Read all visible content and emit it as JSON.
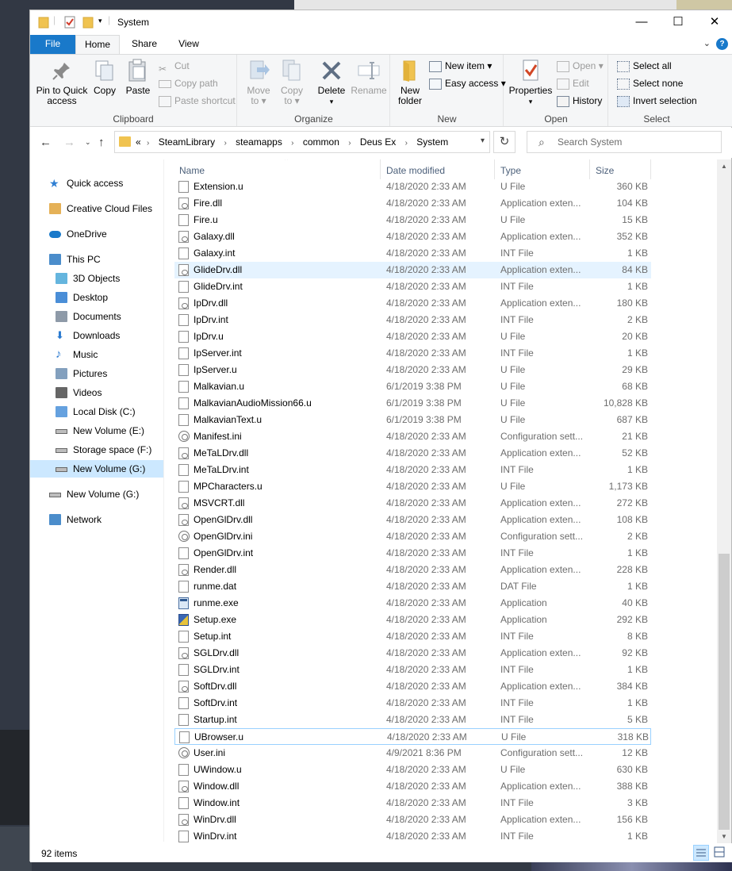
{
  "window": {
    "title": "System",
    "minimize": "—",
    "maximize": "☐",
    "close": "✕"
  },
  "ribbon_tabs": [
    "File",
    "Home",
    "Share",
    "View"
  ],
  "ribbon": {
    "clipboard": {
      "label": "Clipboard",
      "pin": "Pin to Quick access",
      "pin_line1": "Pin to Quick",
      "pin_line2": "access",
      "copy": "Copy",
      "paste": "Paste",
      "cut": "Cut",
      "copy_path": "Copy path",
      "paste_shortcut": "Paste shortcut"
    },
    "organize": {
      "label": "Organize",
      "move_to_line1": "Move",
      "move_to_line2": "to ▾",
      "copy_to_line1": "Copy",
      "copy_to_line2": "to ▾",
      "delete": "Delete",
      "delete_arrow": "▾",
      "rename": "Rename"
    },
    "new": {
      "label": "New",
      "new_folder_line1": "New",
      "new_folder_line2": "folder",
      "new_item": "New item ▾",
      "easy_access": "Easy access ▾"
    },
    "open": {
      "label": "Open",
      "properties": "Properties",
      "properties_arrow": "▾",
      "open": "Open ▾",
      "edit": "Edit",
      "history": "History"
    },
    "select": {
      "label": "Select",
      "select_all": "Select all",
      "select_none": "Select none",
      "invert_selection": "Invert selection"
    }
  },
  "address": {
    "overflow": "«",
    "crumbs": [
      "SteamLibrary",
      "steamapps",
      "common",
      "Deus Ex",
      "System"
    ],
    "separator": "›"
  },
  "search": {
    "placeholder": "Search System"
  },
  "nav_pane": [
    {
      "label": "Quick access",
      "icon": "star-icon"
    },
    {
      "label": "Creative Cloud Files",
      "icon": "creative-cloud-icon"
    },
    {
      "label": "OneDrive",
      "icon": "cloud-icon"
    },
    {
      "label": "This PC",
      "icon": "computer-icon"
    },
    {
      "label": "3D Objects",
      "icon": "cube-icon"
    },
    {
      "label": "Desktop",
      "icon": "desktop-icon"
    },
    {
      "label": "Documents",
      "icon": "document-icon"
    },
    {
      "label": "Downloads",
      "icon": "download-icon"
    },
    {
      "label": "Music",
      "icon": "music-icon"
    },
    {
      "label": "Pictures",
      "icon": "pictures-icon"
    },
    {
      "label": "Videos",
      "icon": "video-icon"
    },
    {
      "label": "Local Disk (C:)",
      "icon": "windows-drive-icon"
    },
    {
      "label": "New Volume (E:)",
      "icon": "drive-icon"
    },
    {
      "label": "Storage space (F:)",
      "icon": "drive-icon"
    },
    {
      "label": "New Volume (G:)",
      "icon": "drive-icon"
    },
    {
      "label": "New Volume (G:)",
      "icon": "drive-icon"
    },
    {
      "label": "Network",
      "icon": "network-icon"
    }
  ],
  "columns": {
    "name": "Name",
    "date": "Date modified",
    "type": "Type",
    "size": "Size"
  },
  "files": [
    {
      "name": "Extension.u",
      "date": "4/18/2020 2:33 AM",
      "type": "U File",
      "size": "360 KB",
      "icon": "file"
    },
    {
      "name": "Fire.dll",
      "date": "4/18/2020 2:33 AM",
      "type": "Application exten...",
      "size": "104 KB",
      "icon": "dll"
    },
    {
      "name": "Fire.u",
      "date": "4/18/2020 2:33 AM",
      "type": "U File",
      "size": "15 KB",
      "icon": "file"
    },
    {
      "name": "Galaxy.dll",
      "date": "4/18/2020 2:33 AM",
      "type": "Application exten...",
      "size": "352 KB",
      "icon": "dll"
    },
    {
      "name": "Galaxy.int",
      "date": "4/18/2020 2:33 AM",
      "type": "INT File",
      "size": "1 KB",
      "icon": "file"
    },
    {
      "name": "GlideDrv.dll",
      "date": "4/18/2020 2:33 AM",
      "type": "Application exten...",
      "size": "84 KB",
      "icon": "dll"
    },
    {
      "name": "GlideDrv.int",
      "date": "4/18/2020 2:33 AM",
      "type": "INT File",
      "size": "1 KB",
      "icon": "file"
    },
    {
      "name": "IpDrv.dll",
      "date": "4/18/2020 2:33 AM",
      "type": "Application exten...",
      "size": "180 KB",
      "icon": "dll"
    },
    {
      "name": "IpDrv.int",
      "date": "4/18/2020 2:33 AM",
      "type": "INT File",
      "size": "2 KB",
      "icon": "file"
    },
    {
      "name": "IpDrv.u",
      "date": "4/18/2020 2:33 AM",
      "type": "U File",
      "size": "20 KB",
      "icon": "file"
    },
    {
      "name": "IpServer.int",
      "date": "4/18/2020 2:33 AM",
      "type": "INT File",
      "size": "1 KB",
      "icon": "file"
    },
    {
      "name": "IpServer.u",
      "date": "4/18/2020 2:33 AM",
      "type": "U File",
      "size": "29 KB",
      "icon": "file"
    },
    {
      "name": "Malkavian.u",
      "date": "6/1/2019 3:38 PM",
      "type": "U File",
      "size": "68 KB",
      "icon": "file"
    },
    {
      "name": "MalkavianAudioMission66.u",
      "date": "6/1/2019 3:38 PM",
      "type": "U File",
      "size": "10,828 KB",
      "icon": "file"
    },
    {
      "name": "MalkavianText.u",
      "date": "6/1/2019 3:38 PM",
      "type": "U File",
      "size": "687 KB",
      "icon": "file"
    },
    {
      "name": "Manifest.ini",
      "date": "4/18/2020 2:33 AM",
      "type": "Configuration sett...",
      "size": "21 KB",
      "icon": "gear"
    },
    {
      "name": "MeTaLDrv.dll",
      "date": "4/18/2020 2:33 AM",
      "type": "Application exten...",
      "size": "52 KB",
      "icon": "dll"
    },
    {
      "name": "MeTaLDrv.int",
      "date": "4/18/2020 2:33 AM",
      "type": "INT File",
      "size": "1 KB",
      "icon": "file"
    },
    {
      "name": "MPCharacters.u",
      "date": "4/18/2020 2:33 AM",
      "type": "U File",
      "size": "1,173 KB",
      "icon": "file"
    },
    {
      "name": "MSVCRT.dll",
      "date": "4/18/2020 2:33 AM",
      "type": "Application exten...",
      "size": "272 KB",
      "icon": "dll"
    },
    {
      "name": "OpenGlDrv.dll",
      "date": "4/18/2020 2:33 AM",
      "type": "Application exten...",
      "size": "108 KB",
      "icon": "dll"
    },
    {
      "name": "OpenGlDrv.ini",
      "date": "4/18/2020 2:33 AM",
      "type": "Configuration sett...",
      "size": "2 KB",
      "icon": "gear"
    },
    {
      "name": "OpenGlDrv.int",
      "date": "4/18/2020 2:33 AM",
      "type": "INT File",
      "size": "1 KB",
      "icon": "file"
    },
    {
      "name": "Render.dll",
      "date": "4/18/2020 2:33 AM",
      "type": "Application exten...",
      "size": "228 KB",
      "icon": "dll"
    },
    {
      "name": "runme.dat",
      "date": "4/18/2020 2:33 AM",
      "type": "DAT File",
      "size": "1 KB",
      "icon": "file"
    },
    {
      "name": "runme.exe",
      "date": "4/18/2020 2:33 AM",
      "type": "Application",
      "size": "40 KB",
      "icon": "app"
    },
    {
      "name": "Setup.exe",
      "date": "4/18/2020 2:33 AM",
      "type": "Application",
      "size": "292 KB",
      "icon": "setup"
    },
    {
      "name": "Setup.int",
      "date": "4/18/2020 2:33 AM",
      "type": "INT File",
      "size": "8 KB",
      "icon": "file"
    },
    {
      "name": "SGLDrv.dll",
      "date": "4/18/2020 2:33 AM",
      "type": "Application exten...",
      "size": "92 KB",
      "icon": "dll"
    },
    {
      "name": "SGLDrv.int",
      "date": "4/18/2020 2:33 AM",
      "type": "INT File",
      "size": "1 KB",
      "icon": "file"
    },
    {
      "name": "SoftDrv.dll",
      "date": "4/18/2020 2:33 AM",
      "type": "Application exten...",
      "size": "384 KB",
      "icon": "dll"
    },
    {
      "name": "SoftDrv.int",
      "date": "4/18/2020 2:33 AM",
      "type": "INT File",
      "size": "1 KB",
      "icon": "file"
    },
    {
      "name": "Startup.int",
      "date": "4/18/2020 2:33 AM",
      "type": "INT File",
      "size": "5 KB",
      "icon": "file"
    },
    {
      "name": "UBrowser.u",
      "date": "4/18/2020 2:33 AM",
      "type": "U File",
      "size": "318 KB",
      "icon": "file"
    },
    {
      "name": "User.ini",
      "date": "4/9/2021 8:36 PM",
      "type": "Configuration sett...",
      "size": "12 KB",
      "icon": "gear"
    },
    {
      "name": "UWindow.u",
      "date": "4/18/2020 2:33 AM",
      "type": "U File",
      "size": "630 KB",
      "icon": "file"
    },
    {
      "name": "Window.dll",
      "date": "4/18/2020 2:33 AM",
      "type": "Application exten...",
      "size": "388 KB",
      "icon": "dll"
    },
    {
      "name": "Window.int",
      "date": "4/18/2020 2:33 AM",
      "type": "INT File",
      "size": "3 KB",
      "icon": "file"
    },
    {
      "name": "WinDrv.dll",
      "date": "4/18/2020 2:33 AM",
      "type": "Application exten...",
      "size": "156 KB",
      "icon": "dll"
    },
    {
      "name": "WinDrv.int",
      "date": "4/18/2020 2:33 AM",
      "type": "INT File",
      "size": "1 KB",
      "icon": "file"
    }
  ],
  "hovered_file": "GlideDrv.dll",
  "focused_file": "UBrowser.u",
  "selected_nav": "New Volume (G:)",
  "status": {
    "item_count": "92 items"
  },
  "colors": {
    "accent": "#1979ca",
    "hover": "#e5f3ff",
    "selection": "#cce8ff",
    "folder": "#f0c350"
  }
}
